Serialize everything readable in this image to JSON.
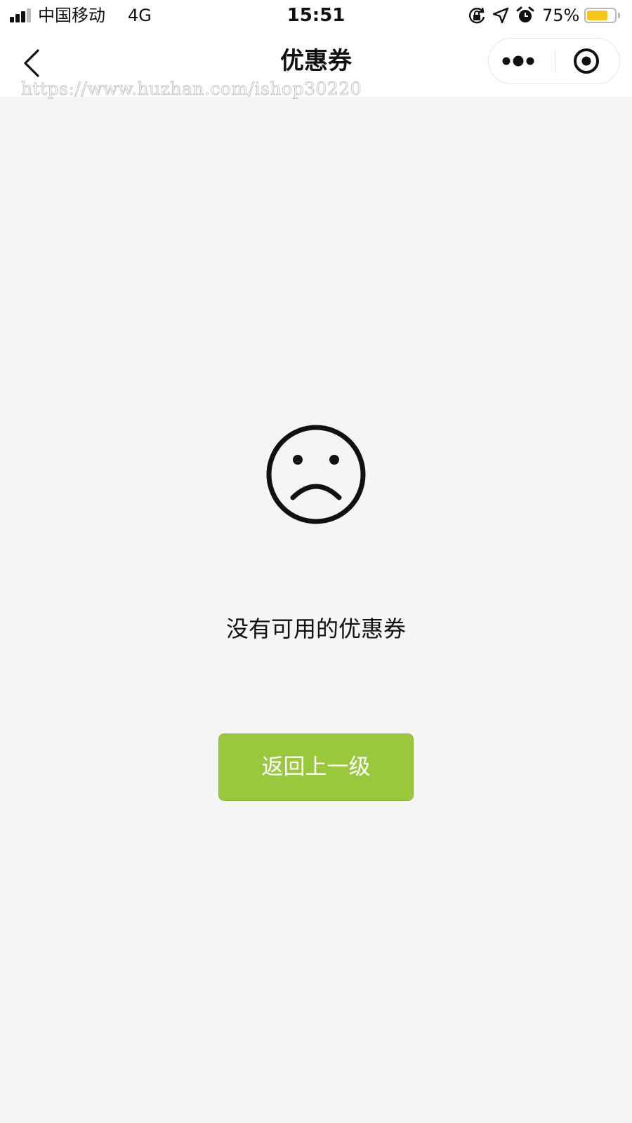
{
  "status_bar": {
    "carrier": "中国移动",
    "network": "4G",
    "time": "15:51",
    "battery_percent_label": "75%",
    "battery_level": 0.75,
    "icons": [
      "orientation-lock-icon",
      "location-arrow-icon",
      "alarm-clock-icon"
    ]
  },
  "nav": {
    "title": "优惠券",
    "back_icon": "chevron-left-icon",
    "capsule_icons": [
      "more-dots-icon",
      "close-target-icon"
    ]
  },
  "watermark": "https://www.huzhan.com/ishop30220",
  "empty_state": {
    "icon": "sad-face-icon",
    "message": "没有可用的优惠券",
    "button_label": "返回上一级"
  },
  "colors": {
    "background": "#f5f5f5",
    "button_green": "#99c83d",
    "battery_yellow": "#f5c518"
  }
}
